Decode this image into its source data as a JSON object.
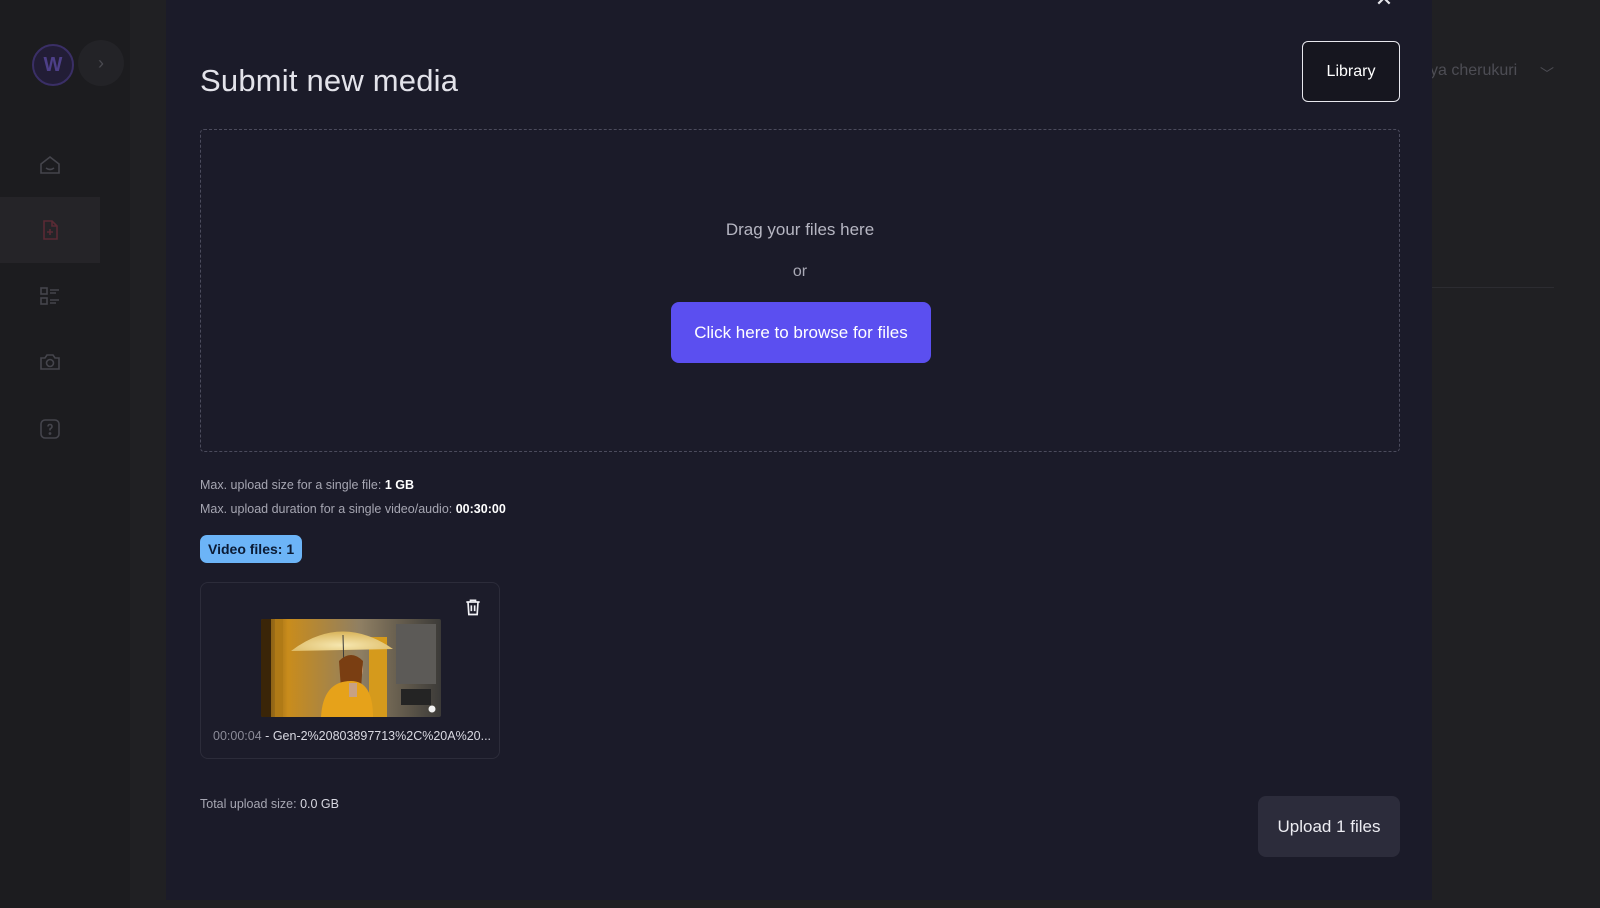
{
  "background": {
    "logo_text": "W",
    "expand_icon": "chevron-right-icon",
    "nav_items": [
      {
        "icon": "home-icon"
      },
      {
        "icon": "file-add-icon",
        "active": true,
        "accent": "#5a2a34"
      },
      {
        "icon": "list-icon"
      },
      {
        "icon": "camera-icon"
      },
      {
        "icon": "help-icon"
      }
    ],
    "user_name": "ya cherukuri",
    "user_chevron": "chevron-down-icon"
  },
  "modal": {
    "title": "Submit new media",
    "library_button": "Library",
    "close_icon": "close-icon",
    "dropzone": {
      "drag_text": "Drag your files here",
      "or_text": "or",
      "browse_button": "Click here to browse for files"
    },
    "limits": {
      "size_label": "Max. upload size for a single file:",
      "size_value": "1 GB",
      "duration_label": "Max. upload duration for a single video/audio:",
      "duration_value": "00:30:00"
    },
    "file_badge": "Video files: 1",
    "files": [
      {
        "duration": "00:00:04",
        "separator": "-",
        "name": "Gen-2%20803897713%2C%20A%20...",
        "delete_icon": "trash-icon"
      }
    ],
    "total_label": "Total upload size:",
    "total_value": "0.0 GB",
    "upload_button": "Upload 1 files"
  },
  "colors": {
    "modal_bg": "#1b1b29",
    "primary": "#5b4ff0",
    "badge": "#6cb4f7",
    "upload_btn": "#2c2c3b"
  }
}
